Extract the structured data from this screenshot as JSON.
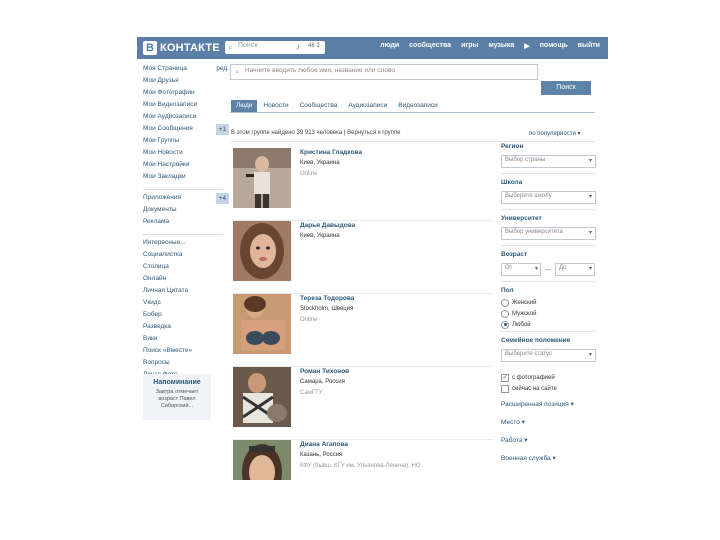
{
  "header": {
    "logo_letter": "B",
    "logo_text": "КОНТАКТЕ",
    "search_placeholder": "Поиск",
    "search_count": "48 1",
    "nav": [
      "люди",
      "сообщества",
      "игры",
      "музыка",
      "▶",
      "помощь",
      "выйти"
    ]
  },
  "sidebar": {
    "items": [
      {
        "label": "Моя Страница",
        "badge": "ред.",
        "badge_box": false
      },
      {
        "label": "Мои Друзья",
        "badge": "",
        "badge_box": false
      },
      {
        "label": "Мои Фотографии",
        "badge": "",
        "badge_box": false
      },
      {
        "label": "Мои Видеозаписи",
        "badge": "",
        "badge_box": false
      },
      {
        "label": "Мои Аудиозаписи",
        "badge": "",
        "badge_box": false
      },
      {
        "label": "Мои Сообщения",
        "badge": "+1",
        "badge_box": true
      },
      {
        "label": "Мои Группы",
        "badge": "",
        "badge_box": false
      },
      {
        "label": "Мои Новости",
        "badge": "",
        "badge_box": false
      },
      {
        "label": "Мои Настройки",
        "badge": "",
        "badge_box": false
      },
      {
        "label": "Мои Закладки",
        "badge": "",
        "badge_box": false
      }
    ],
    "items2": [
      {
        "label": "Приложения",
        "badge": "+4",
        "badge_box": true
      },
      {
        "label": "Документы",
        "badge": "",
        "badge_box": false
      },
      {
        "label": "Реклама",
        "badge": "",
        "badge_box": false
      }
    ],
    "items3": [
      {
        "label": "Интересные..."
      },
      {
        "label": "Социалистка"
      },
      {
        "label": "Столица"
      },
      {
        "label": "Онлайн"
      },
      {
        "label": "Личная Цитата"
      },
      {
        "label": "Vкидс"
      },
      {
        "label": "Бобер"
      },
      {
        "label": "Разведка"
      },
      {
        "label": "Вики"
      },
      {
        "label": "Поиск «Вместе»"
      },
      {
        "label": "Вопросы"
      },
      {
        "label": "Лента Фото"
      }
    ],
    "reminder_title": "Напоминание",
    "reminder_text": "Завтра отмечает возраст Павел Сибирский..."
  },
  "search": {
    "placeholder": "Начните вводить любое имя, название или слово",
    "button": "Поиск"
  },
  "tabs": [
    "Люди",
    "Новости",
    "Сообщества",
    "Аудиозаписи",
    "Видеозаписи"
  ],
  "results": {
    "summary": "В этом группе найдено 39 913 человека | Вернуться к группе",
    "sort": "по популярности ▾"
  },
  "people": [
    {
      "name": "Кристина Гладкова",
      "line1": "Киев, Украина",
      "line2": "Online",
      "avatar": "avatar-1"
    },
    {
      "name": "Дарья Давыдова",
      "line1": "Киев, Украина",
      "line2": "",
      "avatar": "avatar-2"
    },
    {
      "name": "Тереза Тодорова",
      "line1": "Stockholm, Швеция",
      "line2": "Online",
      "avatar": "avatar-3"
    },
    {
      "name": "Роман Тихонов",
      "line1": "Самара, Россия",
      "line2": "СамГТУ",
      "avatar": "avatar-4"
    },
    {
      "name": "Диана Агапова",
      "line1": "Казань, Россия",
      "line2": "КФУ (бывш. КГУ им. Ульянова-Ленина), НО",
      "avatar": "avatar-5"
    }
  ],
  "filters": {
    "region_title": "Регион",
    "region_value": "Выбор страны",
    "school_title": "Школа",
    "school_value": "Выберите школу",
    "uni_title": "Университет",
    "uni_value": "Выбор университета",
    "age_title": "Возраст",
    "age_from": "От",
    "age_dash": "—",
    "age_to": "До",
    "sex_title": "Пол",
    "sex_options": [
      "Женский",
      "Мужской",
      "Любой"
    ],
    "marital_title": "Семейное положение",
    "marital_value": "Выберите статус",
    "photo_check": "с фотографией",
    "online_check": "сейчас на сайте",
    "expand1": "Расширенная позиция ▾",
    "expand2": "Место ▾",
    "expand3": "Работа ▾",
    "expand4": "Военная служба ▾"
  },
  "colors": {
    "header": "#5b7fa6",
    "link": "#2b587a",
    "button": "#5e82a8"
  }
}
